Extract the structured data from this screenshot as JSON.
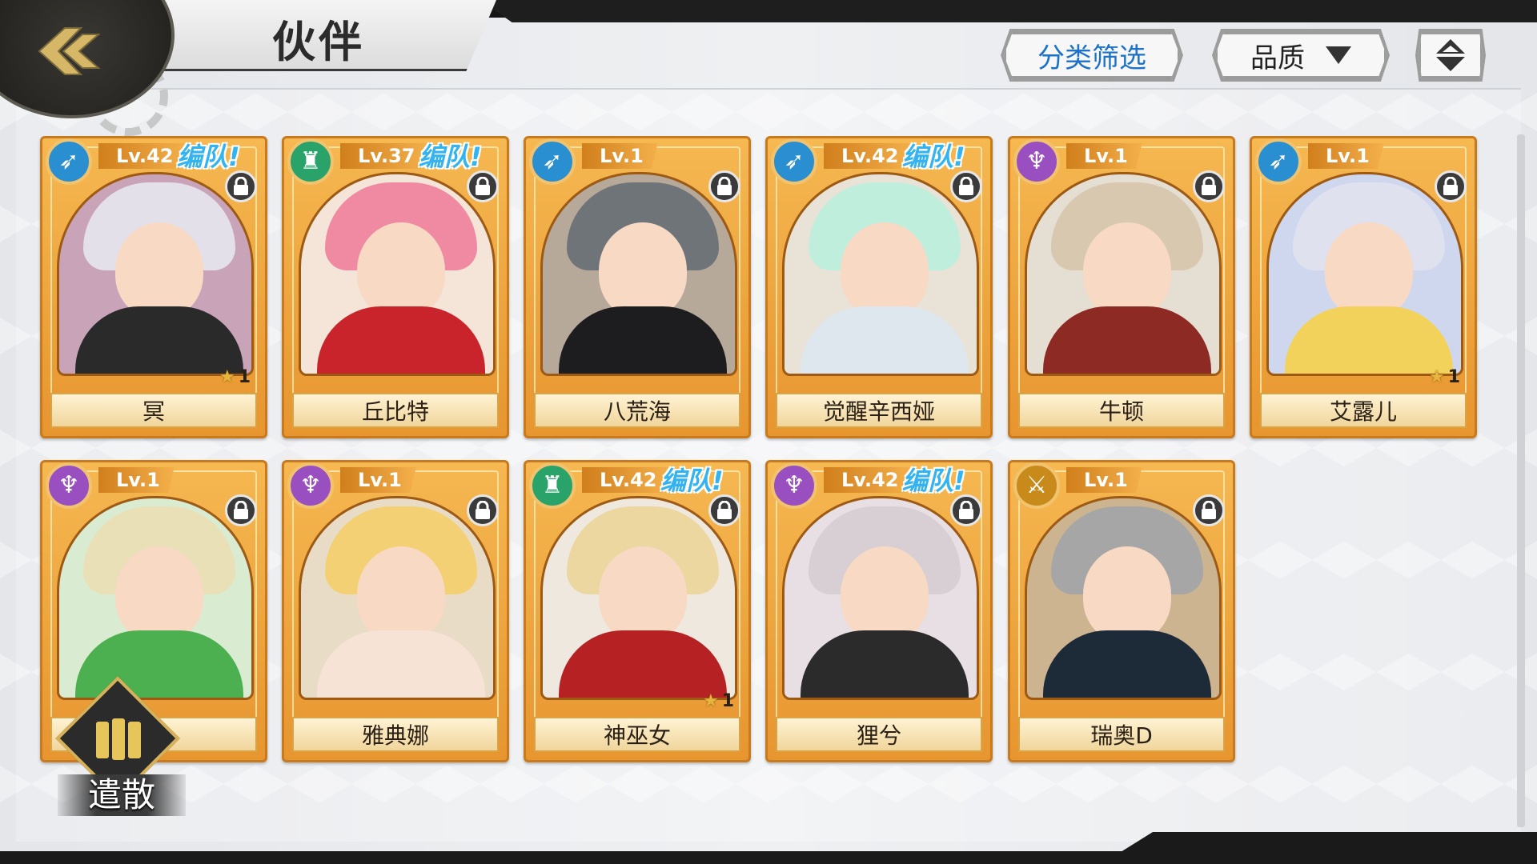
{
  "header": {
    "title": "伙伴",
    "back_icon": "back-arrow-icon",
    "filter_label": "分类筛选",
    "quality_label": "品质",
    "sort_icon": "sort-toggle-icon"
  },
  "dismiss": {
    "label": "遣散"
  },
  "team_label": "编队!",
  "colors": {
    "card_gold": "#f0a53d",
    "team_blue": "#33b3ef",
    "filter_blue": "#1c72c8"
  },
  "cards": [
    {
      "name": "冥",
      "level": "Lv.42",
      "in_team": true,
      "stars": "1",
      "class": "archer",
      "class_color": "#2a8fd0",
      "hair": "#e4e0ea",
      "outfit": "#2a2a2a",
      "bg": "#c9a4b8"
    },
    {
      "name": "丘比特",
      "level": "Lv.37",
      "in_team": true,
      "stars": "",
      "class": "support",
      "class_color": "#2aa36a",
      "hair": "#f08aa2",
      "outfit": "#c9242b",
      "bg": "#f4e5d8"
    },
    {
      "name": "八荒海",
      "level": "Lv.1",
      "in_team": false,
      "stars": "",
      "class": "archer",
      "class_color": "#2a8fd0",
      "hair": "#6f7479",
      "outfit": "#1d1d1f",
      "bg": "#b7a99a"
    },
    {
      "name": "觉醒辛西娅",
      "level": "Lv.42",
      "in_team": true,
      "stars": "",
      "class": "archer",
      "class_color": "#2a8fd0",
      "hair": "#bfeedd",
      "outfit": "#dfe7ee",
      "bg": "#e9e2d6"
    },
    {
      "name": "牛顿",
      "level": "Lv.1",
      "in_team": false,
      "stars": "",
      "class": "mage",
      "class_color": "#9a4fc1",
      "hair": "#d8c8b0",
      "outfit": "#8d2a24",
      "bg": "#e5ded2"
    },
    {
      "name": "艾露儿",
      "level": "Lv.1",
      "in_team": false,
      "stars": "1",
      "class": "archer",
      "class_color": "#2a8fd0",
      "hair": "#dfe1ef",
      "outfit": "#f2d25a",
      "bg": "#cfd7ee"
    },
    {
      "name": "",
      "level": "Lv.1",
      "in_team": false,
      "stars": "",
      "class": "mage",
      "class_color": "#9a4fc1",
      "hair": "#e9e0b8",
      "outfit": "#4caf50",
      "bg": "#d9ebd1"
    },
    {
      "name": "雅典娜",
      "level": "Lv.1",
      "in_team": false,
      "stars": "",
      "class": "mage",
      "class_color": "#9a4fc1",
      "hair": "#f3d073",
      "outfit": "#f6e3d6",
      "bg": "#e9dcc7"
    },
    {
      "name": "神巫女",
      "level": "Lv.42",
      "in_team": true,
      "stars": "1",
      "class": "support",
      "class_color": "#2aa36a",
      "hair": "#ecd7a1",
      "outfit": "#b62224",
      "bg": "#efe8df"
    },
    {
      "name": "狸兮",
      "level": "Lv.42",
      "in_team": true,
      "stars": "",
      "class": "mage",
      "class_color": "#9a4fc1",
      "hair": "#d7cfd3",
      "outfit": "#2b2b2b",
      "bg": "#e8dfe4"
    },
    {
      "name": "瑞奥D",
      "level": "Lv.1",
      "in_team": false,
      "stars": "",
      "class": "warrior",
      "class_color": "#c88a1a",
      "hair": "#a6a6a6",
      "outfit": "#1d2a38",
      "bg": "#cbb48f"
    }
  ]
}
